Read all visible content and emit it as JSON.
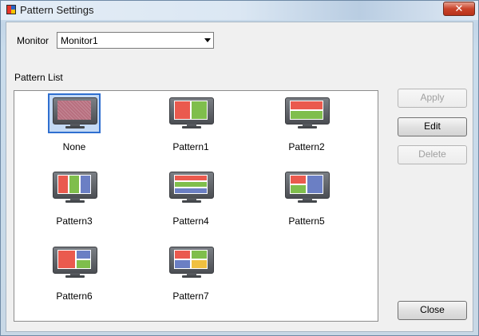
{
  "window": {
    "title": "Pattern Settings",
    "close_glyph": "✕"
  },
  "monitor": {
    "label": "Monitor",
    "selected": "Monitor1"
  },
  "pattern_list": {
    "label": "Pattern List",
    "items": [
      {
        "label": "None",
        "selected": true
      },
      {
        "label": "Pattern1"
      },
      {
        "label": "Pattern2"
      },
      {
        "label": "Pattern3"
      },
      {
        "label": "Pattern4"
      },
      {
        "label": "Pattern5"
      },
      {
        "label": "Pattern6"
      },
      {
        "label": "Pattern7"
      }
    ]
  },
  "buttons": {
    "apply": "Apply",
    "edit": "Edit",
    "delete": "Delete",
    "close": "Close"
  },
  "colors": {
    "red": "#ea5a4e",
    "green": "#7fbe4c",
    "blue": "#6b7fc4",
    "yellow": "#f0c040",
    "none_fill": "#b86f7f",
    "selection": "#2f6fd0"
  }
}
